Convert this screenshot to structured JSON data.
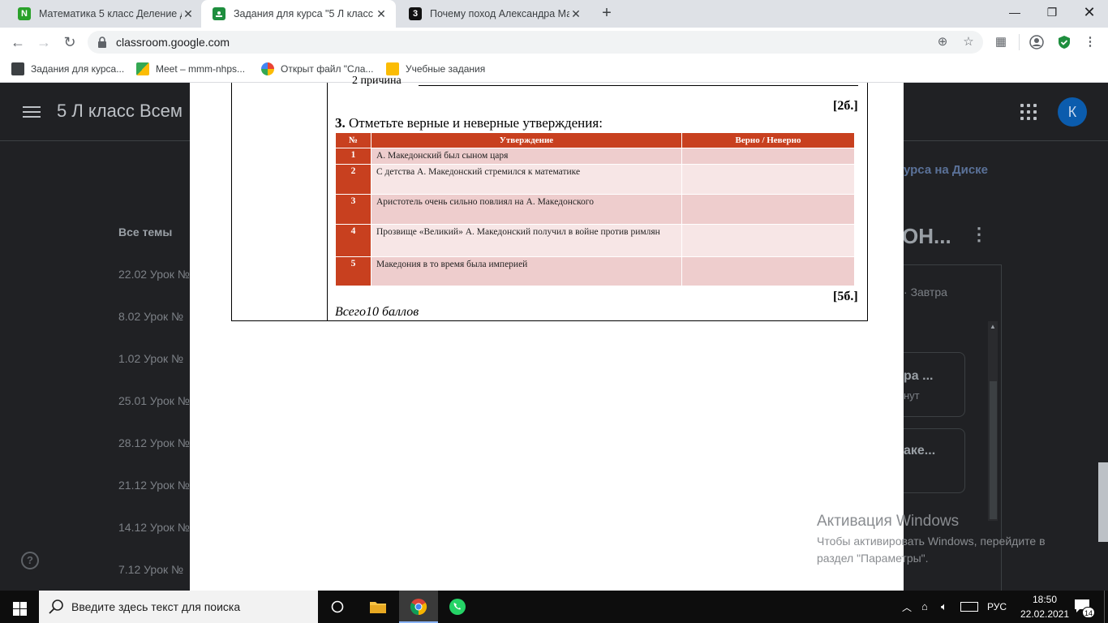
{
  "browser": {
    "tabs": [
      {
        "title": "Математика 5 класс Деление де",
        "favicon_letter": "N",
        "favicon_color": "#2aa12a",
        "active": false
      },
      {
        "title": "Задания для курса \"5 Л класс Вс",
        "favicon_letter": "",
        "favicon_color": "#1e8e3e",
        "active": true
      },
      {
        "title": "Почему поход Александра Мак",
        "favicon_letter": "3",
        "favicon_color": "#111111",
        "active": false
      }
    ],
    "url": "classroom.google.com",
    "bookmarks": [
      {
        "label": "Задания для курса..."
      },
      {
        "label": "Meet – mmm-nhps..."
      },
      {
        "label": "Открыт файл \"Сла..."
      },
      {
        "label": "Учебные задания"
      }
    ]
  },
  "classroom": {
    "course_title": "5 Л класс Всем",
    "avatar_letter": "К",
    "all_topics": "Все темы",
    "topics": [
      "22.02 Урок №",
      "8.02 Урок №",
      "1.02 Урок №",
      "25.01 Урок №",
      "28.12 Урок №",
      "21.12 Урок №",
      "14.12 Урок №",
      "7.12 Урок №"
    ],
    "drive_link": "урса на Диске",
    "assignment_heading": "ОН...",
    "due_tomorrow": "Завтра",
    "cards": [
      {
        "title": "ра ...",
        "sub": "нут"
      },
      {
        "title": "аке...",
        "sub": ""
      }
    ]
  },
  "document": {
    "cut_text": "2 причина",
    "points_prev": "[2б.]",
    "question_number": "3.",
    "question_text": "Отметьте верные и неверные утверждения:",
    "table": {
      "headers": [
        "№",
        "Утверждение",
        "Верно / Неверно"
      ],
      "rows": [
        {
          "num": "1",
          "text": "А. Македонский был сыном царя",
          "answer": ""
        },
        {
          "num": "2",
          "text": "С детства А. Македонский стремился к математике",
          "answer": ""
        },
        {
          "num": "3",
          "text": "Аристотель очень сильно повлиял на А. Македонского",
          "answer": ""
        },
        {
          "num": "4",
          "text": "Прозвище «Великий» А. Македонский получил в войне против римлян",
          "answer": ""
        },
        {
          "num": "5",
          "text": "Македония в то время была империей",
          "answer": ""
        }
      ]
    },
    "points_table": "[5б.]",
    "total": "Всего10 баллов"
  },
  "watermark": {
    "title": "Активация Windows",
    "subtitle": "Чтобы активировать Windows, перейдите в раздел \"Параметры\"."
  },
  "taskbar": {
    "search_placeholder": "Введите здесь текст для поиска",
    "language": "РУС",
    "time": "18:50",
    "date": "22.02.2021",
    "notification_count": "14"
  }
}
